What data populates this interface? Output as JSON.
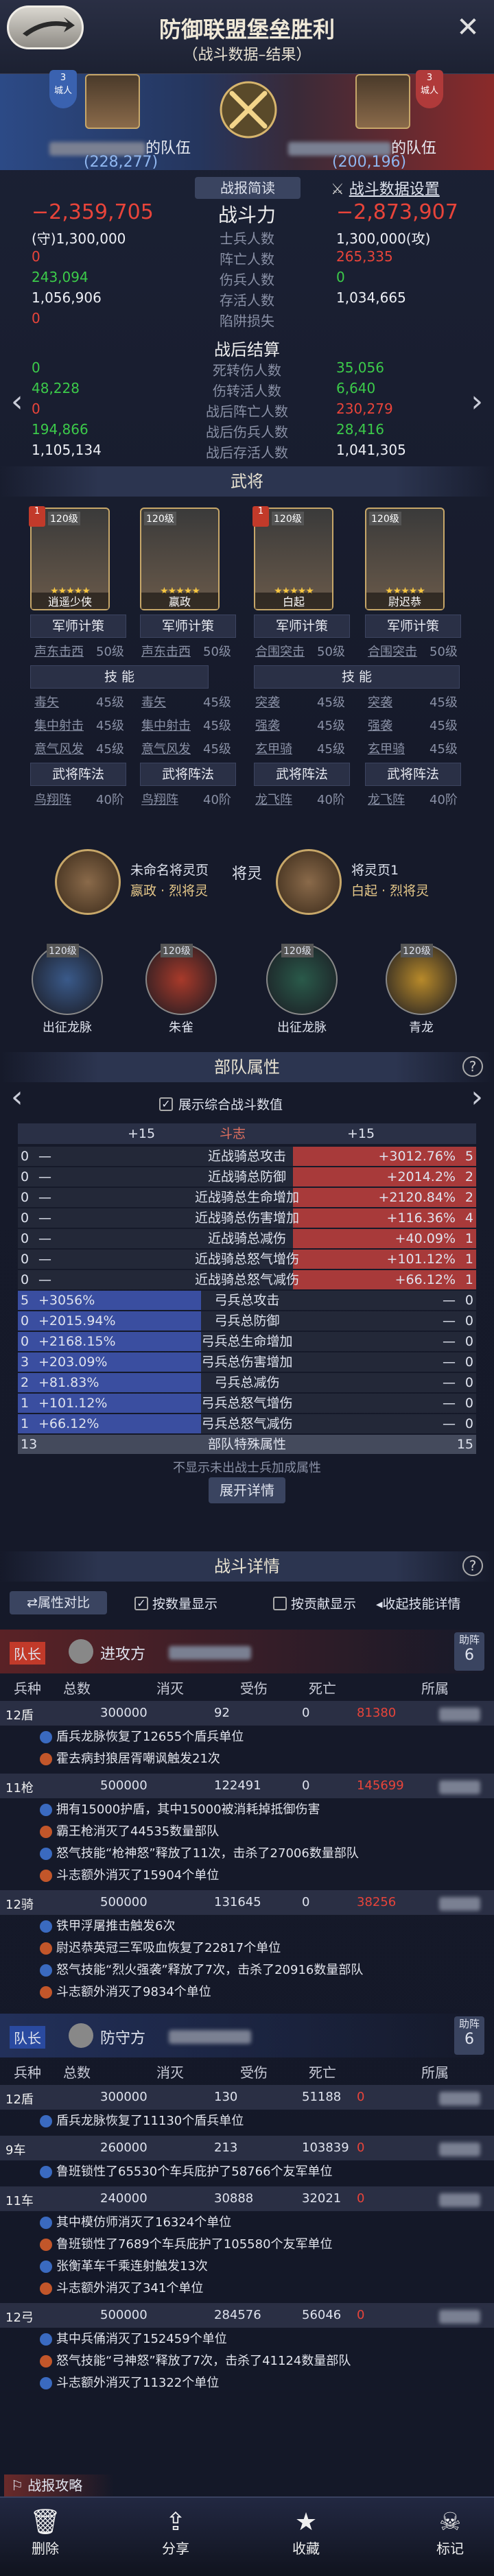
{
  "header": {
    "title": "防御联盟堡垒胜利",
    "subtitle": "（战斗数据–结果）",
    "close": "✕"
  },
  "vs": {
    "left": {
      "rank": "3",
      "rank_label": "城人",
      "team_suffix": "的队伍",
      "power": "(228,277)"
    },
    "right": {
      "rank": "3",
      "rank_label": "城人",
      "team_suffix": "的队伍",
      "power": "(200,196)"
    }
  },
  "summary": {
    "tab_brief": "战报简读",
    "settings": "战斗数据设置",
    "power_label": "战斗力",
    "left_power_loss": "−2,359,705",
    "right_power_loss": "−2,873,907",
    "rows": [
      {
        "label": "士兵人数",
        "left": "(守)1,300,000",
        "right": "1,300,000(攻)",
        "lc": "white",
        "rc": "white"
      },
      {
        "label": "阵亡人数",
        "left": "0",
        "right": "265,335",
        "lc": "red",
        "rc": "red"
      },
      {
        "label": "伤兵人数",
        "left": "243,094",
        "right": "0",
        "lc": "green",
        "rc": "green"
      },
      {
        "label": "存活人数",
        "left": "1,056,906",
        "right": "1,034,665",
        "lc": "white",
        "rc": "white"
      },
      {
        "label": "陷阱损失",
        "left": "0",
        "right": "",
        "lc": "red",
        "rc": "red"
      }
    ],
    "after_title": "战后结算",
    "after_rows": [
      {
        "label": "死转伤人数",
        "left": "0",
        "right": "35,056",
        "lc": "green",
        "rc": "green"
      },
      {
        "label": "伤转活人数",
        "left": "48,228",
        "right": "6,640",
        "lc": "green",
        "rc": "green"
      },
      {
        "label": "战后阵亡人数",
        "left": "0",
        "right": "230,279",
        "lc": "red",
        "rc": "red"
      },
      {
        "label": "战后伤兵人数",
        "left": "194,866",
        "right": "28,416",
        "lc": "green",
        "rc": "green"
      },
      {
        "label": "战后存活人数",
        "left": "1,105,134",
        "right": "1,041,305",
        "lc": "white",
        "rc": "white"
      }
    ]
  },
  "generals": {
    "title": "武将",
    "cards": [
      {
        "level": "120级",
        "name": "逍遥少侠",
        "badge": "1"
      },
      {
        "level": "120级",
        "name": "嬴政",
        "badge": ""
      },
      {
        "level": "120级",
        "name": "白起",
        "badge": "1"
      },
      {
        "level": "120级",
        "name": "尉迟恭",
        "badge": ""
      }
    ],
    "skill_names": [
      "军师计策",
      "军师计策",
      "军师计策",
      "军师计策"
    ],
    "skill_lines": [
      {
        "a": "声东击西",
        "al": "50级",
        "b": "声东击西",
        "bl": "50级",
        "c": "合围突击",
        "cl": "50级",
        "d": "合围突击",
        "dl": "50级"
      }
    ],
    "ability_title": "技 能",
    "abilities": [
      {
        "a": "毒矢",
        "al": "45级",
        "b": "毒矢",
        "bl": "45级",
        "c": "突袭",
        "cl": "45级",
        "d": "突袭",
        "dl": "45级"
      },
      {
        "a": "集中射击",
        "al": "45级",
        "b": "集中射击",
        "bl": "45级",
        "c": "强袭",
        "cl": "45级",
        "d": "强袭",
        "dl": "45级"
      },
      {
        "a": "意气风发",
        "al": "45级",
        "b": "意气风发",
        "bl": "45级",
        "c": "玄甲骑",
        "cl": "45级",
        "d": "玄甲骑",
        "dl": "45级"
      }
    ],
    "formation_title": "武将阵法",
    "formations": [
      {
        "a": "鸟翔阵",
        "al": "40阶",
        "b": "鸟翔阵",
        "bl": "40阶",
        "c": "龙飞阵",
        "cl": "40阶",
        "d": "龙飞阵",
        "dl": "40阶"
      }
    ]
  },
  "spirits": {
    "title": "将灵",
    "left": {
      "page": "未命名将灵页",
      "owner": "嬴政 · 烈将灵"
    },
    "right": {
      "page": "将灵页1",
      "owner": "白起 · 烈将灵"
    },
    "beasts": [
      {
        "name": "出征龙脉",
        "level": "120级"
      },
      {
        "name": "朱雀",
        "level": "120级"
      },
      {
        "name": "出征龙脉",
        "level": "120级"
      },
      {
        "name": "青龙",
        "level": "120级"
      }
    ]
  },
  "attributes": {
    "title": "部队属性",
    "show_combined": "展示综合战斗数值",
    "header": {
      "left": "+15",
      "mid": "斗志",
      "right": "+15"
    },
    "rows": [
      {
        "n": "0",
        "l": "—",
        "label": "近战骑总攻击",
        "r": "+3012.76%",
        "rn": "5",
        "lw": 0,
        "rw": 80
      },
      {
        "n": "0",
        "l": "—",
        "label": "近战骑总防御",
        "r": "+2014.2%",
        "rn": "2",
        "lw": 0,
        "rw": 80
      },
      {
        "n": "0",
        "l": "—",
        "label": "近战骑总生命增加",
        "r": "+2120.84%",
        "rn": "2",
        "lw": 0,
        "rw": 80
      },
      {
        "n": "0",
        "l": "—",
        "label": "近战骑总伤害增加",
        "r": "+116.36%",
        "rn": "4",
        "lw": 0,
        "rw": 80
      },
      {
        "n": "0",
        "l": "—",
        "label": "近战骑总减伤",
        "r": "+40.09%",
        "rn": "1",
        "lw": 0,
        "rw": 80
      },
      {
        "n": "0",
        "l": "—",
        "label": "近战骑总怒气增伤",
        "r": "+101.12%",
        "rn": "1",
        "lw": 0,
        "rw": 80
      },
      {
        "n": "0",
        "l": "—",
        "label": "近战骑总怒气减伤",
        "r": "+66.12%",
        "rn": "1",
        "lw": 0,
        "rw": 80
      },
      {
        "n": "5",
        "l": "+3056%",
        "label": "弓兵总攻击",
        "r": "—",
        "rn": "0",
        "lw": 80,
        "rw": 0
      },
      {
        "n": "0",
        "l": "+2015.94%",
        "label": "弓兵总防御",
        "r": "—",
        "rn": "0",
        "lw": 80,
        "rw": 0
      },
      {
        "n": "0",
        "l": "+2168.15%",
        "label": "弓兵总生命增加",
        "r": "—",
        "rn": "0",
        "lw": 80,
        "rw": 0
      },
      {
        "n": "3",
        "l": "+203.09%",
        "label": "弓兵总伤害增加",
        "r": "—",
        "rn": "0",
        "lw": 80,
        "rw": 0
      },
      {
        "n": "2",
        "l": "+81.83%",
        "label": "弓兵总减伤",
        "r": "—",
        "rn": "0",
        "lw": 80,
        "rw": 0
      },
      {
        "n": "1",
        "l": "+101.12%",
        "label": "弓兵总怒气增伤",
        "r": "—",
        "rn": "0",
        "lw": 80,
        "rw": 0
      },
      {
        "n": "1",
        "l": "+66.12%",
        "label": "弓兵总怒气减伤",
        "r": "—",
        "rn": "0",
        "lw": 80,
        "rw": 0
      },
      {
        "n": "13",
        "l": "",
        "label": "部队特殊属性",
        "r": "",
        "rn": "15",
        "lw": 0,
        "rw": 0
      }
    ],
    "note": "不显示未出战士兵加成属性",
    "expand": "展开详情"
  },
  "details": {
    "title": "战斗详情",
    "compare": "属性对比",
    "by_count": "按数量显示",
    "by_contrib": "按贡献显示",
    "collapse": "收起技能详情",
    "columns": [
      "兵种",
      "总数",
      "消灭",
      "受伤",
      "死亡",
      "所属"
    ],
    "attacker": {
      "role": "队长",
      "side": "进攻方",
      "help_label": "助阵",
      "help_count": "6"
    },
    "defender": {
      "role": "队长",
      "side": "防守方",
      "help_label": "助阵",
      "help_count": "6"
    },
    "attack_units": [
      {
        "type": "12盾",
        "total": "300000",
        "kill": "92",
        "hurt": "0",
        "dead": "81380",
        "logs": [
          "盾兵龙脉恢复了12655个盾兵单位",
          "霍去病封狼居胥嘲讽触发21次"
        ]
      },
      {
        "type": "11枪",
        "total": "500000",
        "kill": "122491",
        "hurt": "0",
        "dead": "145699",
        "logs": [
          "拥有15000护盾，其中15000被消耗掉抵御伤害",
          "霸王枪消灭了44535数量部队",
          "怒气技能“枪神怒”释放了11次，击杀了27006数量部队",
          "斗志额外消灭了15904个单位"
        ]
      },
      {
        "type": "12骑",
        "total": "500000",
        "kill": "131645",
        "hurt": "0",
        "dead": "38256",
        "logs": [
          "铁甲浮屠推击触发6次",
          "尉迟恭英冠三军吸血恢复了22817个单位",
          "怒气技能“烈火强袭”释放了7次，击杀了20916数量部队",
          "斗志额外消灭了9834个单位"
        ]
      }
    ],
    "defend_units": [
      {
        "type": "12盾",
        "total": "300000",
        "kill": "130",
        "hurt": "51188",
        "dead": "0",
        "logs": [
          "盾兵龙脉恢复了11130个盾兵单位"
        ]
      },
      {
        "type": "9车",
        "total": "260000",
        "kill": "213",
        "hurt": "103839",
        "dead": "0",
        "logs": [
          "鲁班锁性了65530个车兵庇护了58766个友军单位"
        ]
      },
      {
        "type": "11车",
        "total": "240000",
        "kill": "30888",
        "hurt": "32021",
        "dead": "0",
        "logs": [
          "其中模仿师消灭了16324个单位",
          "鲁班锁性了7689个车兵庇护了105580个友军单位",
          "张衡革车千乘连射触发13次",
          "斗志额外消灭了341个单位"
        ]
      },
      {
        "type": "12弓",
        "total": "500000",
        "kill": "284576",
        "hurt": "56046",
        "dead": "0",
        "logs": [
          "其中兵俑消灭了152459个单位",
          "怒气技能“弓神怒”释放了7次，击杀了41124数量部队",
          "斗志额外消灭了11322个单位"
        ]
      }
    ],
    "report_tips": "战报攻略"
  },
  "nav": [
    {
      "label": "删除",
      "icon": "trash-icon",
      "glyph": "🗑"
    },
    {
      "label": "分享",
      "icon": "share-icon",
      "glyph": "⇪"
    },
    {
      "label": "收藏",
      "icon": "star-icon",
      "glyph": "★"
    },
    {
      "label": "标记",
      "icon": "skull-icon",
      "glyph": "☠"
    }
  ]
}
